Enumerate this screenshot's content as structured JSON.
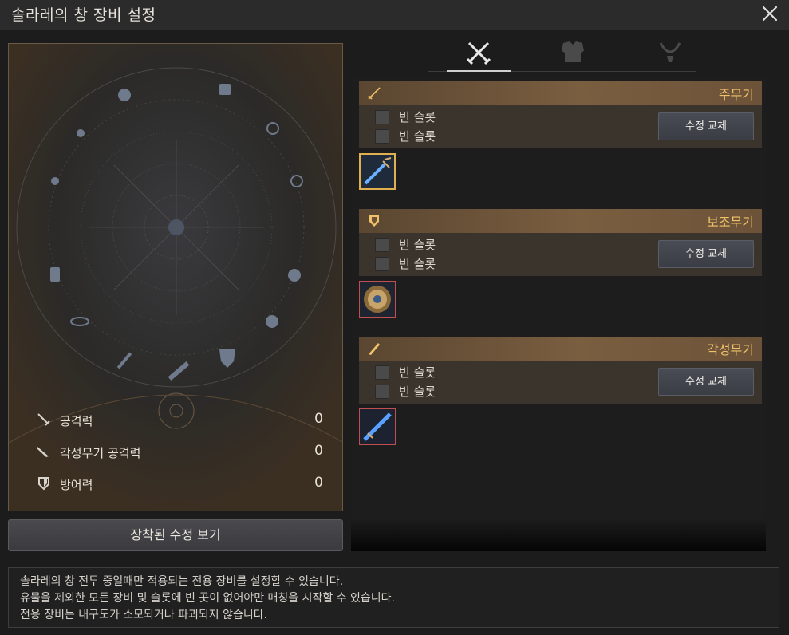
{
  "window": {
    "title": "솔라레의 창 장비 설정"
  },
  "tabs": [
    {
      "name": "weapons",
      "icon": "crossed-swords-icon",
      "active": true
    },
    {
      "name": "armor",
      "icon": "armor-icon",
      "active": false
    },
    {
      "name": "accessory",
      "icon": "necklace-icon",
      "active": false
    }
  ],
  "stats": [
    {
      "icon": "sword-icon",
      "label": "공격력",
      "value": "0"
    },
    {
      "icon": "awakening-sword-icon",
      "label": "각성무기 공격력",
      "value": "0"
    },
    {
      "icon": "shield-icon",
      "label": "방어력",
      "value": "0"
    }
  ],
  "view_button": "장착된 수정 보기",
  "sections": [
    {
      "title": "주무기",
      "icon": "rapier-icon",
      "slots": [
        "빈 슬롯",
        "빈 슬롯"
      ],
      "button": "수정 교체",
      "item": "blue-rapier-icon"
    },
    {
      "title": "보조무기",
      "icon": "shield-icon",
      "slots": [
        "빈 슬롯",
        "빈 슬롯"
      ],
      "button": "수정 교체",
      "item": "round-shield-icon"
    },
    {
      "title": "각성무기",
      "icon": "greatsword-icon",
      "slots": [
        "빈 슬롯",
        "빈 슬롯"
      ],
      "button": "수정 교체",
      "item": "blue-blade-icon"
    }
  ],
  "help": [
    "솔라레의 창 전투 중일때만 적용되는 전용 장비를 설정할 수 있습니다.",
    "유물을 제외한 모든 장비 및 슬롯에 빈 곳이 없어야만 매칭을 시작할 수 있습니다.",
    "전용 장비는 내구도가 소모되거나 파괴되지 않습니다."
  ],
  "colors": {
    "accent_gold": "#f0c36a",
    "header_brown": "#7a5e40",
    "frame_gold": "#6a5a45"
  }
}
